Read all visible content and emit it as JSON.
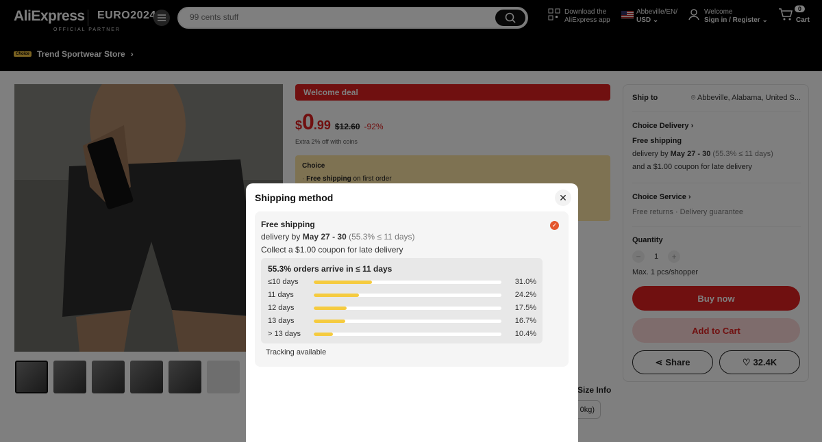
{
  "header": {
    "logo": "AliExpress",
    "euro": "EURO2024",
    "partner": "OFFICIAL PARTNER",
    "search_placeholder": "99 cents stuff",
    "download_line1": "Download the",
    "download_line2": "AliExpress app",
    "location_line1": "Abbeville/EN/",
    "location_line2": "USD",
    "welcome": "Welcome",
    "signin": "Sign in / Register",
    "cart_count": "0",
    "cart_label": "Cart"
  },
  "store": {
    "choice_tag": "Choice",
    "name": "Trend Sportwear Store"
  },
  "product": {
    "promo": "Welcome deal",
    "currency": "$",
    "price_main": "0",
    "price_cents": ".99",
    "price_old": "$12.60",
    "discount": "-92%",
    "coins": "Extra 2% off with coins",
    "choice_title": "Choice",
    "choice_item_bold": "Free shipping",
    "choice_item_rest": " on first order",
    "size_info": "Size Info",
    "size_value": "0kg)"
  },
  "side": {
    "ship_to_label": "Ship to",
    "ship_to_value": "Abbeville, Alabama, United S...",
    "choice_delivery": "Choice Delivery",
    "free_shipping": "Free shipping",
    "delivery_prefix": "delivery by ",
    "delivery_dates": "May 27 - 30",
    "delivery_stat": " (55.3% ≤ 11 days)",
    "coupon": "and a $1.00 coupon for late delivery",
    "choice_service": "Choice Service",
    "service_detail": "Free returns · Delivery guarantee",
    "quantity_label": "Quantity",
    "quantity_value": "1",
    "max_note": "Max. 1 pcs/shopper",
    "buy_now": "Buy now",
    "add_to_cart": "Add to Cart",
    "share": "Share",
    "wishlist": "32.4K"
  },
  "modal": {
    "title": "Shipping method",
    "ship_title": "Free shipping",
    "delivery_prefix": "delivery by ",
    "delivery_dates": "May 27 - 30",
    "delivery_stat": " (55.3% ≤ 11 days)",
    "coupon": "Collect a $1.00 coupon for late delivery",
    "dist_title": "55.3% orders arrive in ≤ 11 days",
    "distribution": [
      {
        "label": "≤10 days",
        "pct": "31.0%",
        "value": 31.0
      },
      {
        "label": "11 days",
        "pct": "24.2%",
        "value": 24.2
      },
      {
        "label": "12 days",
        "pct": "17.5%",
        "value": 17.5
      },
      {
        "label": "13 days",
        "pct": "16.7%",
        "value": 16.7
      },
      {
        "label": "> 13 days",
        "pct": "10.4%",
        "value": 10.4
      }
    ],
    "tracking": "Tracking available"
  },
  "colors": {
    "brand_red": "#e02020",
    "bar_yellow": "#f5cb3f",
    "check_orange": "#e4572e"
  }
}
